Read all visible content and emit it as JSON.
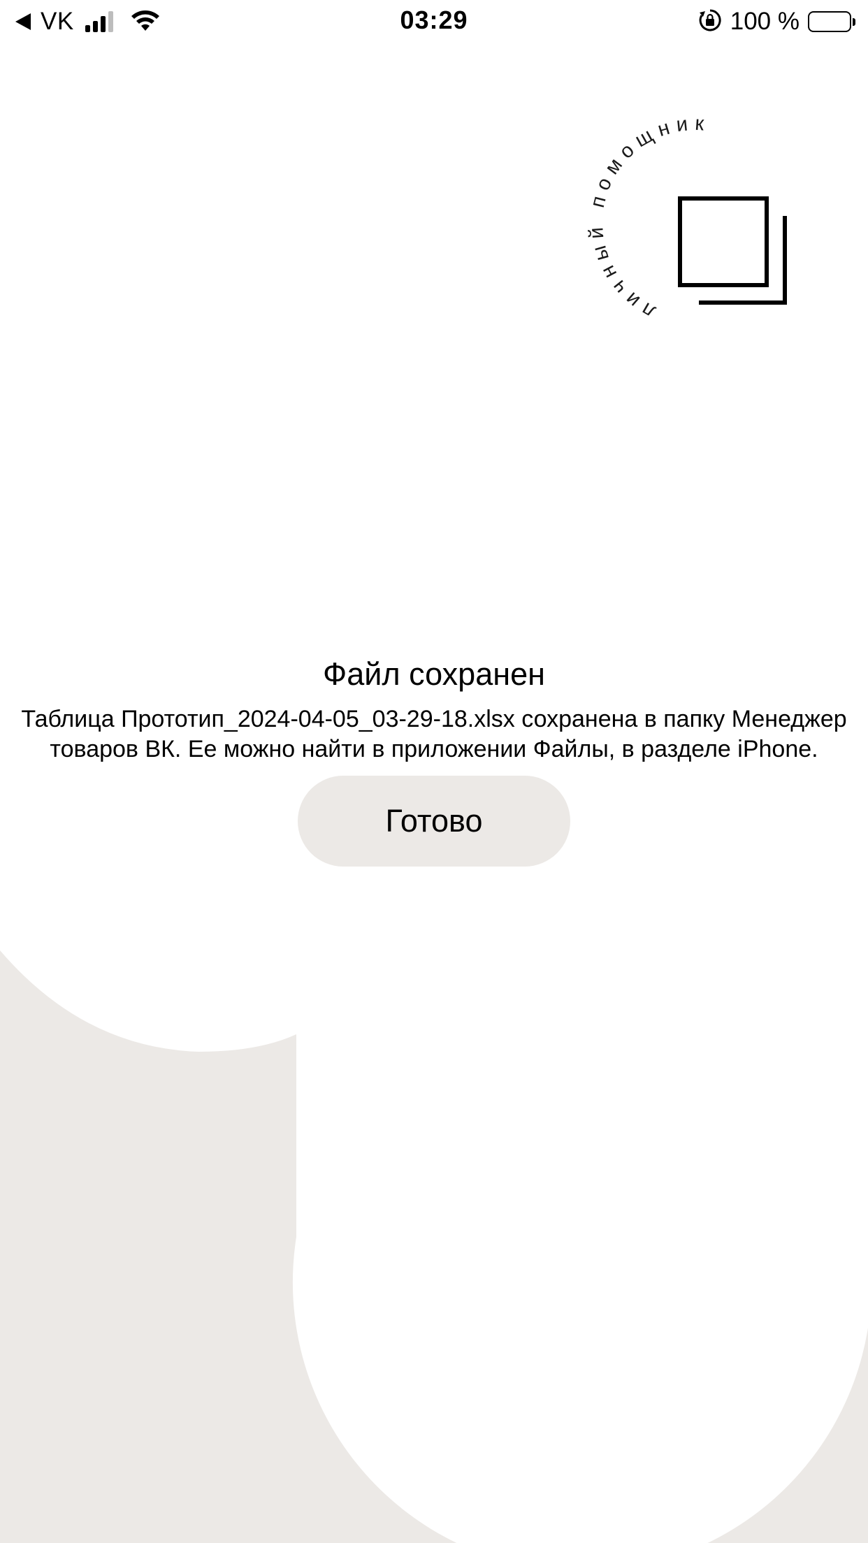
{
  "status_bar": {
    "back_icon": "back-triangle-icon",
    "carrier": "VK",
    "signal_icon": "cellular-signal-icon",
    "wifi_icon": "wifi-icon",
    "time": "03:29",
    "orientation_lock_icon": "orientation-lock-icon",
    "battery_text": "100 %",
    "battery_icon": "battery-icon",
    "battery_level": 1.0
  },
  "logo": {
    "curved_text": "личный помощник",
    "icon": "stacked-squares-icon"
  },
  "dialog": {
    "title": "Файл сохранен",
    "message": "Таблица Прототип_2024-04-05_03-29-18.xlsx сохранена в папку Менеджер товаров ВК. Ее можно найти в приложении Файлы, в разделе iPhone.",
    "done_label": "Готово"
  },
  "colors": {
    "background": "#ffffff",
    "accent_beige": "#ece9e6",
    "text": "#000000"
  }
}
